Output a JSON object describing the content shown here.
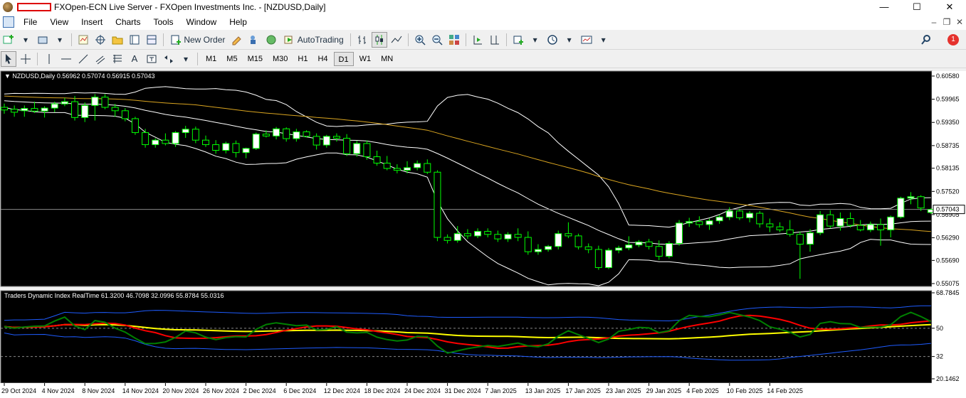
{
  "window": {
    "title": "FXOpen-ECN Live Server - FXOpen Investments Inc. - [NZDUSD,Daily]",
    "controls": [
      "—",
      "☐",
      "✕"
    ]
  },
  "menu": {
    "items": [
      "File",
      "View",
      "Insert",
      "Charts",
      "Tools",
      "Window",
      "Help"
    ],
    "right_controls": [
      "–",
      "❐",
      "✕"
    ]
  },
  "toolbar": {
    "new_order_label": "New Order",
    "autotrading_label": "AutoTrading",
    "notification_count": "1"
  },
  "timeframes": {
    "items": [
      "M1",
      "M5",
      "M15",
      "M30",
      "H1",
      "H4",
      "D1",
      "W1",
      "MN"
    ],
    "active": "D1"
  },
  "colors": {
    "background": "#000000",
    "grid_text": "#ffffff",
    "bull_candle": "#ffffff",
    "bear_candle": "#000000",
    "candle_wick": "#00ff00",
    "bollinger": "#ffffff",
    "ma": "#daa520",
    "tdi_band": "#1e5cff",
    "tdi_mid": "#ffff00",
    "tdi_signal": "#ff0000",
    "tdi_rsi": "#008000"
  },
  "chart_data": {
    "type": "candlestick",
    "symbol_header": "NZDUSD,Daily  0.56962 0.57074 0.56915 0.57043",
    "current_price_label": "0.57043",
    "current_price": 0.57043,
    "price_axis_labels": [
      "0.60580",
      "0.59965",
      "0.59350",
      "0.58735",
      "0.58135",
      "0.57520",
      "0.56905",
      "0.56290",
      "0.55690",
      "0.55075"
    ],
    "price_axis_values": [
      0.6058,
      0.59965,
      0.5935,
      0.58735,
      0.58135,
      0.5752,
      0.56905,
      0.5629,
      0.5569,
      0.55075
    ],
    "date_labels": [
      "29 Oct 2024",
      "4 Nov 2024",
      "8 Nov 2024",
      "14 Nov 2024",
      "20 Nov 2024",
      "26 Nov 2024",
      "2 Dec 2024",
      "6 Dec 2024",
      "12 Dec 2024",
      "18 Dec 2024",
      "24 Dec 2024",
      "31 Dec 2024",
      "7 Jan 2025",
      "13 Jan 2025",
      "17 Jan 2025",
      "23 Jan 2025",
      "29 Jan 2025",
      "4 Feb 2025",
      "10 Feb 2025",
      "14 Feb 2025"
    ],
    "candles": [
      {
        "o": 0.5975,
        "h": 0.5985,
        "l": 0.5958,
        "c": 0.5968
      },
      {
        "o": 0.597,
        "h": 0.598,
        "l": 0.595,
        "c": 0.5962
      },
      {
        "o": 0.5966,
        "h": 0.598,
        "l": 0.595,
        "c": 0.5972
      },
      {
        "o": 0.5972,
        "h": 0.599,
        "l": 0.596,
        "c": 0.5965
      },
      {
        "o": 0.5965,
        "h": 0.5978,
        "l": 0.5948,
        "c": 0.5973
      },
      {
        "o": 0.5973,
        "h": 0.599,
        "l": 0.5962,
        "c": 0.5984
      },
      {
        "o": 0.5984,
        "h": 0.6,
        "l": 0.5978,
        "c": 0.599
      },
      {
        "o": 0.599,
        "h": 0.6005,
        "l": 0.594,
        "c": 0.5948
      },
      {
        "o": 0.5948,
        "h": 0.5988,
        "l": 0.5936,
        "c": 0.598
      },
      {
        "o": 0.598,
        "h": 0.601,
        "l": 0.594,
        "c": 0.6002
      },
      {
        "o": 0.6002,
        "h": 0.601,
        "l": 0.597,
        "c": 0.5975
      },
      {
        "o": 0.5975,
        "h": 0.5984,
        "l": 0.595,
        "c": 0.5966
      },
      {
        "o": 0.5966,
        "h": 0.5973,
        "l": 0.5938,
        "c": 0.5945
      },
      {
        "o": 0.5945,
        "h": 0.595,
        "l": 0.5902,
        "c": 0.5908
      },
      {
        "o": 0.5908,
        "h": 0.5918,
        "l": 0.5868,
        "c": 0.5876
      },
      {
        "o": 0.5876,
        "h": 0.5893,
        "l": 0.5868,
        "c": 0.5888
      },
      {
        "o": 0.5888,
        "h": 0.5906,
        "l": 0.5874,
        "c": 0.5879
      },
      {
        "o": 0.5879,
        "h": 0.5912,
        "l": 0.587,
        "c": 0.5908
      },
      {
        "o": 0.5908,
        "h": 0.5926,
        "l": 0.5894,
        "c": 0.5917
      },
      {
        "o": 0.5917,
        "h": 0.5924,
        "l": 0.588,
        "c": 0.5888
      },
      {
        "o": 0.5888,
        "h": 0.59,
        "l": 0.587,
        "c": 0.5876
      },
      {
        "o": 0.5876,
        "h": 0.5888,
        "l": 0.5852,
        "c": 0.5861
      },
      {
        "o": 0.5861,
        "h": 0.5884,
        "l": 0.5853,
        "c": 0.5879
      },
      {
        "o": 0.5879,
        "h": 0.5887,
        "l": 0.5842,
        "c": 0.5855
      },
      {
        "o": 0.5855,
        "h": 0.5868,
        "l": 0.584,
        "c": 0.5866
      },
      {
        "o": 0.5866,
        "h": 0.5908,
        "l": 0.5862,
        "c": 0.5904
      },
      {
        "o": 0.5904,
        "h": 0.5914,
        "l": 0.5895,
        "c": 0.5899
      },
      {
        "o": 0.5899,
        "h": 0.5923,
        "l": 0.589,
        "c": 0.5918
      },
      {
        "o": 0.5918,
        "h": 0.5922,
        "l": 0.5884,
        "c": 0.5892
      },
      {
        "o": 0.5892,
        "h": 0.5918,
        "l": 0.5884,
        "c": 0.591
      },
      {
        "o": 0.591,
        "h": 0.5914,
        "l": 0.5895,
        "c": 0.5898
      },
      {
        "o": 0.5898,
        "h": 0.5906,
        "l": 0.5863,
        "c": 0.5875
      },
      {
        "o": 0.5875,
        "h": 0.5902,
        "l": 0.5868,
        "c": 0.5898
      },
      {
        "o": 0.5898,
        "h": 0.5906,
        "l": 0.5884,
        "c": 0.5893
      },
      {
        "o": 0.5893,
        "h": 0.5904,
        "l": 0.5846,
        "c": 0.5852
      },
      {
        "o": 0.5852,
        "h": 0.5886,
        "l": 0.5844,
        "c": 0.5879
      },
      {
        "o": 0.5879,
        "h": 0.5887,
        "l": 0.5836,
        "c": 0.5844
      },
      {
        "o": 0.5844,
        "h": 0.586,
        "l": 0.582,
        "c": 0.5827
      },
      {
        "o": 0.5827,
        "h": 0.5846,
        "l": 0.5808,
        "c": 0.5813
      },
      {
        "o": 0.5813,
        "h": 0.5824,
        "l": 0.58,
        "c": 0.5808
      },
      {
        "o": 0.5808,
        "h": 0.5832,
        "l": 0.58,
        "c": 0.5815
      },
      {
        "o": 0.5815,
        "h": 0.5834,
        "l": 0.5808,
        "c": 0.5826
      },
      {
        "o": 0.5826,
        "h": 0.5837,
        "l": 0.5798,
        "c": 0.5803
      },
      {
        "o": 0.5803,
        "h": 0.5808,
        "l": 0.562,
        "c": 0.563
      },
      {
        "o": 0.563,
        "h": 0.5638,
        "l": 0.5614,
        "c": 0.5622
      },
      {
        "o": 0.5622,
        "h": 0.566,
        "l": 0.5616,
        "c": 0.564
      },
      {
        "o": 0.564,
        "h": 0.5652,
        "l": 0.5626,
        "c": 0.5634
      },
      {
        "o": 0.5634,
        "h": 0.5654,
        "l": 0.5628,
        "c": 0.5646
      },
      {
        "o": 0.5646,
        "h": 0.5654,
        "l": 0.563,
        "c": 0.5638
      },
      {
        "o": 0.5638,
        "h": 0.5648,
        "l": 0.5618,
        "c": 0.5626
      },
      {
        "o": 0.5626,
        "h": 0.5644,
        "l": 0.5618,
        "c": 0.5638
      },
      {
        "o": 0.5638,
        "h": 0.5654,
        "l": 0.562,
        "c": 0.563
      },
      {
        "o": 0.563,
        "h": 0.5646,
        "l": 0.5584,
        "c": 0.5592
      },
      {
        "o": 0.5592,
        "h": 0.5612,
        "l": 0.5584,
        "c": 0.5598
      },
      {
        "o": 0.5598,
        "h": 0.561,
        "l": 0.5592,
        "c": 0.5606
      },
      {
        "o": 0.5606,
        "h": 0.5648,
        "l": 0.5598,
        "c": 0.564
      },
      {
        "o": 0.564,
        "h": 0.567,
        "l": 0.5628,
        "c": 0.5634
      },
      {
        "o": 0.5634,
        "h": 0.564,
        "l": 0.5598,
        "c": 0.5605
      },
      {
        "o": 0.5605,
        "h": 0.5614,
        "l": 0.5588,
        "c": 0.5598
      },
      {
        "o": 0.5598,
        "h": 0.5608,
        "l": 0.5544,
        "c": 0.555
      },
      {
        "o": 0.555,
        "h": 0.5602,
        "l": 0.5546,
        "c": 0.5596
      },
      {
        "o": 0.5596,
        "h": 0.5608,
        "l": 0.5588,
        "c": 0.5602
      },
      {
        "o": 0.5602,
        "h": 0.5633,
        "l": 0.5596,
        "c": 0.561
      },
      {
        "o": 0.561,
        "h": 0.5623,
        "l": 0.5604,
        "c": 0.5618
      },
      {
        "o": 0.5618,
        "h": 0.5626,
        "l": 0.5598,
        "c": 0.5606
      },
      {
        "o": 0.5606,
        "h": 0.5622,
        "l": 0.557,
        "c": 0.558
      },
      {
        "o": 0.558,
        "h": 0.562,
        "l": 0.5574,
        "c": 0.5614
      },
      {
        "o": 0.5614,
        "h": 0.5676,
        "l": 0.5608,
        "c": 0.5668
      },
      {
        "o": 0.5668,
        "h": 0.5682,
        "l": 0.5658,
        "c": 0.5672
      },
      {
        "o": 0.5672,
        "h": 0.5686,
        "l": 0.5656,
        "c": 0.5664
      },
      {
        "o": 0.5664,
        "h": 0.568,
        "l": 0.565,
        "c": 0.5674
      },
      {
        "o": 0.5674,
        "h": 0.569,
        "l": 0.5666,
        "c": 0.5684
      },
      {
        "o": 0.5684,
        "h": 0.571,
        "l": 0.5676,
        "c": 0.57
      },
      {
        "o": 0.57,
        "h": 0.5706,
        "l": 0.5676,
        "c": 0.5682
      },
      {
        "o": 0.5682,
        "h": 0.57,
        "l": 0.567,
        "c": 0.5694
      },
      {
        "o": 0.5694,
        "h": 0.57,
        "l": 0.5656,
        "c": 0.5666
      },
      {
        "o": 0.5666,
        "h": 0.568,
        "l": 0.5644,
        "c": 0.5658
      },
      {
        "o": 0.5658,
        "h": 0.567,
        "l": 0.5644,
        "c": 0.565
      },
      {
        "o": 0.565,
        "h": 0.5676,
        "l": 0.5632,
        "c": 0.5638
      },
      {
        "o": 0.5638,
        "h": 0.5646,
        "l": 0.552,
        "c": 0.5612
      },
      {
        "o": 0.5612,
        "h": 0.5652,
        "l": 0.5592,
        "c": 0.5642
      },
      {
        "o": 0.5642,
        "h": 0.57,
        "l": 0.5636,
        "c": 0.569
      },
      {
        "o": 0.569,
        "h": 0.5702,
        "l": 0.5654,
        "c": 0.566
      },
      {
        "o": 0.566,
        "h": 0.5696,
        "l": 0.5648,
        "c": 0.568
      },
      {
        "o": 0.568,
        "h": 0.5696,
        "l": 0.5656,
        "c": 0.5662
      },
      {
        "o": 0.5662,
        "h": 0.5676,
        "l": 0.5646,
        "c": 0.565
      },
      {
        "o": 0.565,
        "h": 0.5672,
        "l": 0.5644,
        "c": 0.5664
      },
      {
        "o": 0.5664,
        "h": 0.568,
        "l": 0.5608,
        "c": 0.565
      },
      {
        "o": 0.565,
        "h": 0.5688,
        "l": 0.563,
        "c": 0.5684
      },
      {
        "o": 0.5684,
        "h": 0.5738,
        "l": 0.568,
        "c": 0.5734
      },
      {
        "o": 0.5734,
        "h": 0.575,
        "l": 0.5718,
        "c": 0.5738
      },
      {
        "o": 0.5738,
        "h": 0.5742,
        "l": 0.57,
        "c": 0.5708
      },
      {
        "o": 0.5696,
        "h": 0.5707,
        "l": 0.5692,
        "c": 0.5704
      }
    ],
    "indicator": {
      "label": "Traders Dynamic Index RealTime 61.3200 46.7098 32.0996 55.8784 55.0316",
      "axis_labels": [
        "68.7845",
        "50",
        "32",
        "20.1462"
      ],
      "axis_values": [
        68.7845,
        50,
        32,
        20.1462
      ],
      "ylim": [
        16,
        73
      ]
    }
  }
}
